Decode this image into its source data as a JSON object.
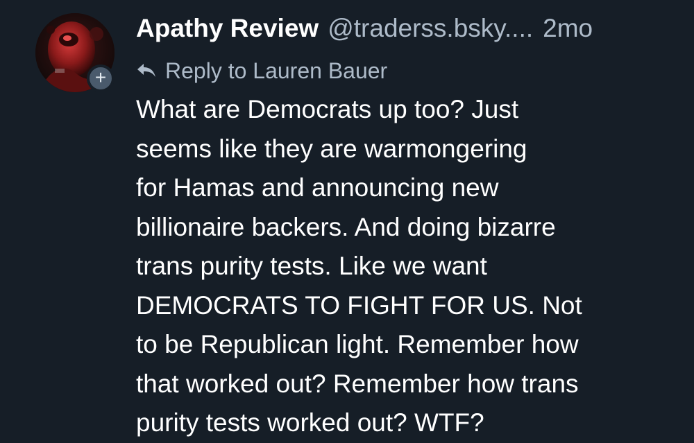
{
  "post": {
    "author": {
      "display_name": "Apathy Review",
      "handle": "@traderss.bsky....",
      "avatar_icon": "red-figure-avatar",
      "follow_badge_label": "+"
    },
    "timestamp": "2mo",
    "reply_to": {
      "icon": "reply-arrow-icon",
      "text": "Reply to Lauren Bauer"
    },
    "body_lines": [
      "What are Democrats up too? Just",
      "seems like they are warmongering",
      "for Hamas and announcing new",
      "billionaire backers. And doing bizarre",
      "trans purity tests. Like we want",
      "DEMOCRATS TO FIGHT FOR US. Not",
      "to be Republican light. Remember how",
      "that worked out? Remember how trans",
      "purity tests worked out? WTF?"
    ]
  },
  "colors": {
    "background": "#161e27",
    "text_primary": "#ffffff",
    "text_secondary": "#aebbc9",
    "badge": "#4a5a6c"
  }
}
